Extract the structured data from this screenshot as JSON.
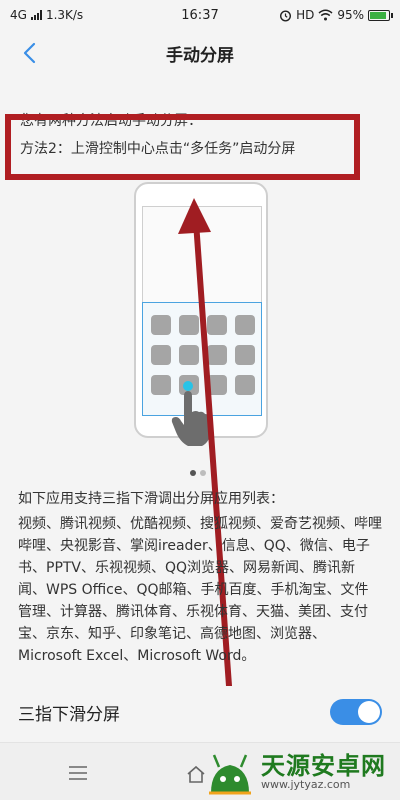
{
  "status_bar": {
    "network": "4G",
    "speed": "1.3K/s",
    "time": "16:37",
    "hd": "HD",
    "battery": "95%",
    "battery_level": 0.95
  },
  "header": {
    "title": "手动分屏"
  },
  "instructions": {
    "intro": "您有两种方法启动手动分屏：",
    "method2": "方法2：上滑控制中心点击“多任务”启动分屏"
  },
  "pager": {
    "pages": 2,
    "active": 1
  },
  "apps": {
    "title": "如下应用支持三指下滑调出分屏应用列表：",
    "list": "视频、腾讯视频、优酷视频、搜狐视频、爱奇艺视频、哔哩哔哩、央视影音、掌阅ireader、信息、QQ、微信、电子书、PPTV、乐视视频、QQ浏览器、网易新闻、腾讯新闻、WPS Office、QQ邮箱、手机百度、手机淘宝、文件管理、计算器、腾讯体育、乐视体育、天猫、美团、支付宝、京东、知乎、印象笔记、高德地图、浏览器、Microsoft Excel、Microsoft Word。"
  },
  "setting": {
    "label": "三指下滑分屏",
    "enabled": true
  },
  "watermark": {
    "name": "天源安卓网",
    "url": "www.jytyaz.com"
  },
  "colors": {
    "highlight": "#b01e22",
    "toggle_on": "#3a8ee6",
    "accent_blue": "#4aa3e0",
    "tap_dot": "#27c3e7",
    "arrow": "#a01d22"
  },
  "icons": {
    "back": "chevron-left-icon",
    "menu": "menu-icon",
    "home": "home-icon",
    "wifi": "wifi-icon",
    "alarm": "alarm-icon",
    "hand": "hand-pointer-icon"
  }
}
